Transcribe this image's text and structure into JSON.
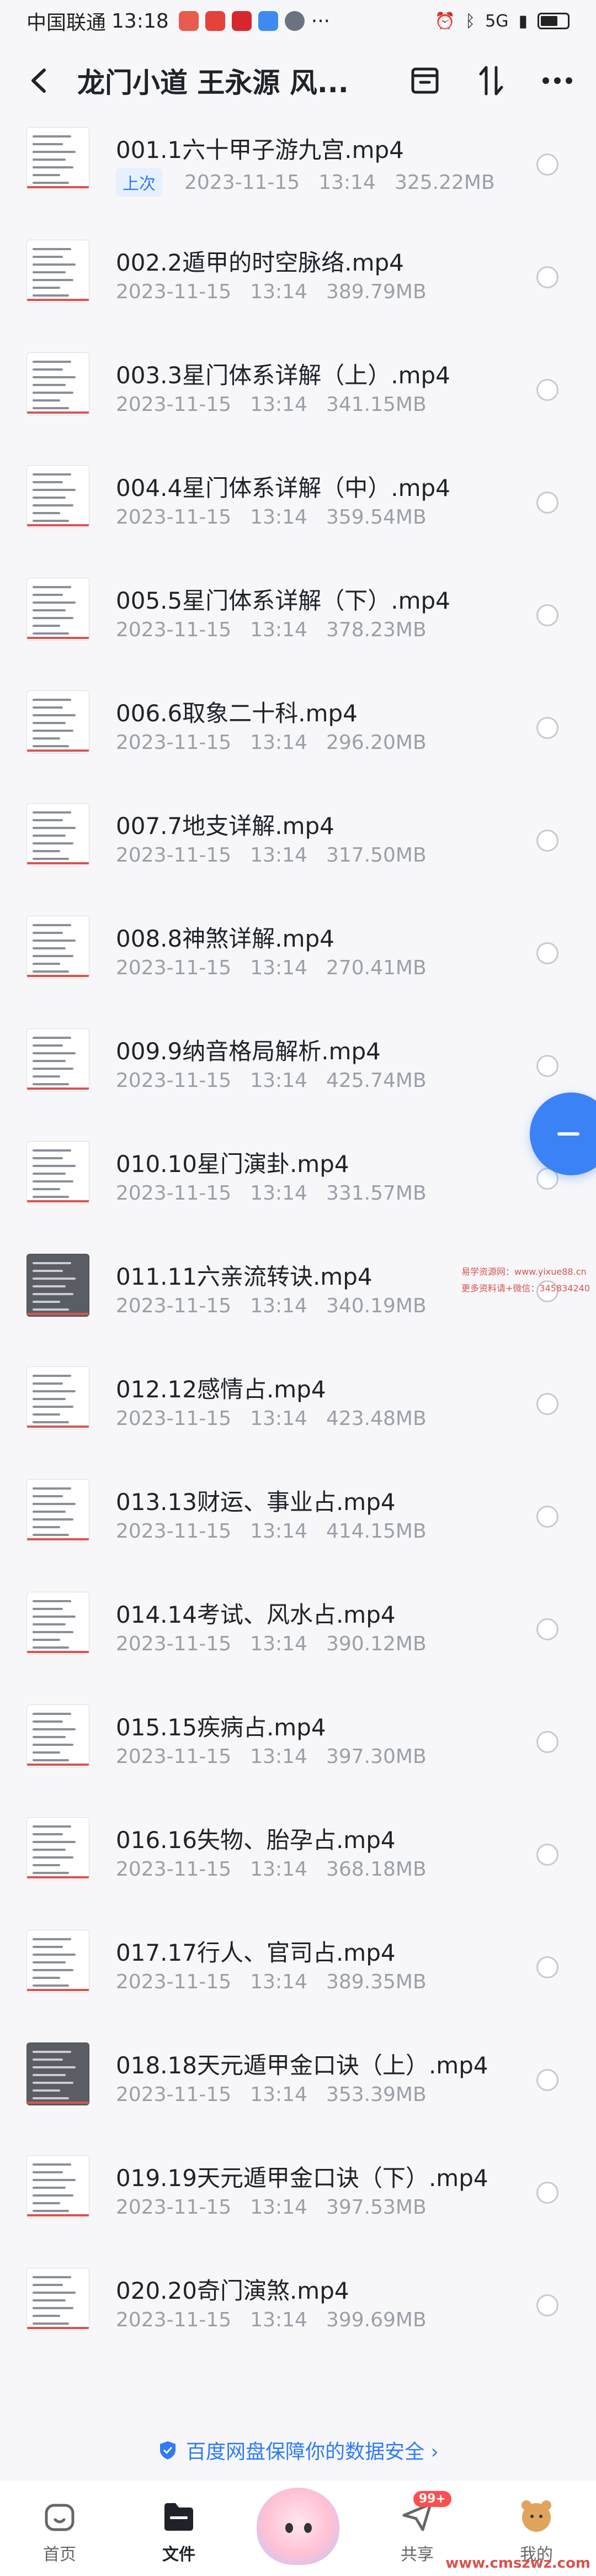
{
  "status_bar": {
    "carrier": "中国联通",
    "time": "13:18",
    "dots": "···",
    "network": "5G"
  },
  "header": {
    "title": "龙门小道 王永源 风..."
  },
  "files": [
    {
      "name": "001.1六十甲子游九宫.mp4",
      "badge": "上次",
      "date": "2023-11-15",
      "time": "13:14",
      "size": "325.22MB",
      "thumb": "light"
    },
    {
      "name": "002.2遁甲的时空脉络.mp4",
      "date": "2023-11-15",
      "time": "13:14",
      "size": "389.79MB",
      "thumb": "light"
    },
    {
      "name": "003.3星门体系详解（上）.mp4",
      "date": "2023-11-15",
      "time": "13:14",
      "size": "341.15MB",
      "thumb": "light"
    },
    {
      "name": "004.4星门体系详解（中）.mp4",
      "date": "2023-11-15",
      "time": "13:14",
      "size": "359.54MB",
      "thumb": "light"
    },
    {
      "name": "005.5星门体系详解（下）.mp4",
      "date": "2023-11-15",
      "time": "13:14",
      "size": "378.23MB",
      "thumb": "light"
    },
    {
      "name": "006.6取象二十科.mp4",
      "date": "2023-11-15",
      "time": "13:14",
      "size": "296.20MB",
      "thumb": "light"
    },
    {
      "name": "007.7地支详解.mp4",
      "date": "2023-11-15",
      "time": "13:14",
      "size": "317.50MB",
      "thumb": "light"
    },
    {
      "name": "008.8神煞详解.mp4",
      "date": "2023-11-15",
      "time": "13:14",
      "size": "270.41MB",
      "thumb": "light"
    },
    {
      "name": "009.9纳音格局解析.mp4",
      "date": "2023-11-15",
      "time": "13:14",
      "size": "425.74MB",
      "thumb": "light"
    },
    {
      "name": "010.10星门演卦.mp4",
      "date": "2023-11-15",
      "time": "13:14",
      "size": "331.57MB",
      "thumb": "light"
    },
    {
      "name": "011.11六亲流转诀.mp4",
      "date": "2023-11-15",
      "time": "13:14",
      "size": "340.19MB",
      "thumb": "dark"
    },
    {
      "name": "012.12感情占.mp4",
      "date": "2023-11-15",
      "time": "13:14",
      "size": "423.48MB",
      "thumb": "light"
    },
    {
      "name": "013.13财运、事业占.mp4",
      "date": "2023-11-15",
      "time": "13:14",
      "size": "414.15MB",
      "thumb": "light"
    },
    {
      "name": "014.14考试、风水占.mp4",
      "date": "2023-11-15",
      "time": "13:14",
      "size": "390.12MB",
      "thumb": "light"
    },
    {
      "name": "015.15疾病占.mp4",
      "date": "2023-11-15",
      "time": "13:14",
      "size": "397.30MB",
      "thumb": "light"
    },
    {
      "name": "016.16失物、胎孕占.mp4",
      "date": "2023-11-15",
      "time": "13:14",
      "size": "368.18MB",
      "thumb": "light"
    },
    {
      "name": "017.17行人、官司占.mp4",
      "date": "2023-11-15",
      "time": "13:14",
      "size": "389.35MB",
      "thumb": "light"
    },
    {
      "name": "018.18天元遁甲金口诀（上）.mp4",
      "date": "2023-11-15",
      "time": "13:14",
      "size": "353.39MB",
      "thumb": "dark"
    },
    {
      "name": "019.19天元遁甲金口诀（下）.mp4",
      "date": "2023-11-15",
      "time": "13:14",
      "size": "397.53MB",
      "thumb": "light"
    },
    {
      "name": "020.20奇门演煞.mp4",
      "date": "2023-11-15",
      "time": "13:14",
      "size": "399.69MB",
      "thumb": "light"
    }
  ],
  "side_watermark": {
    "line1": "易学资源网：www.yixue88.cn",
    "line2": "更多资料请+微信：345834240"
  },
  "promo": {
    "text": "百度网盘保障你的数据安全 ›"
  },
  "nav": {
    "home": "首页",
    "files": "文件",
    "share": "共享",
    "share_badge": "99+",
    "mine": "我的"
  },
  "corner_watermark": "www.cmszwz.com",
  "colors": {
    "accent": "#2f7bf6",
    "meta": "#9ba0a8",
    "badge_bg": "#e6f0ff",
    "notify": "#ff4d4f"
  }
}
